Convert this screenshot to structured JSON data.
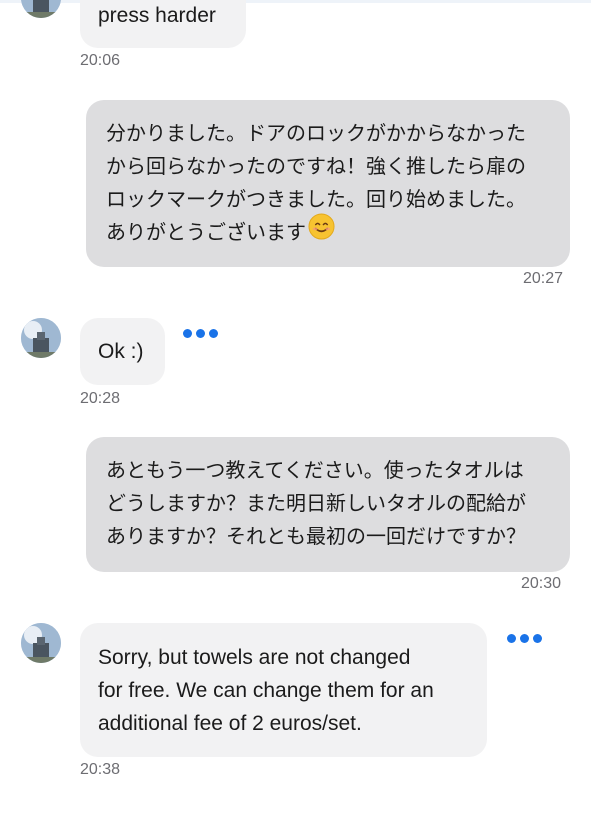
{
  "messages": [
    {
      "direction": "in",
      "lines": [
        "press harder"
      ],
      "time": "20:06"
    },
    {
      "direction": "out",
      "lines": [
        "分かりました。ドアのロックがかからなかった",
        "から回らなかったのですね！強く推したら扉の",
        "ロックマークがつきました。回り始めました。",
        "ありがとうございます"
      ],
      "emoji": "smiling-face-emoji",
      "time": "20:27"
    },
    {
      "direction": "in",
      "lines": [
        "Ok :)"
      ],
      "time": "20:28"
    },
    {
      "direction": "out",
      "lines": [
        "あともう一つ教えてください。使ったタオルは",
        "どうしますか？また明日新しいタオルの配給が",
        "ありますか？それとも最初の一回だけですか？"
      ],
      "time": "20:30"
    },
    {
      "direction": "in",
      "lines": [
        "Sorry, but towels are not changed",
        "for free. We can change them for an",
        "additional fee of 2 euros/set."
      ],
      "time": "20:38"
    }
  ],
  "icons": {
    "more": "more-options-icon",
    "avatar": "avatar"
  },
  "colors": {
    "accent": "#1a73e8",
    "incoming_bubble": "#f2f2f3",
    "outgoing_bubble": "#dddddf",
    "timestamp": "#6d6d72"
  }
}
